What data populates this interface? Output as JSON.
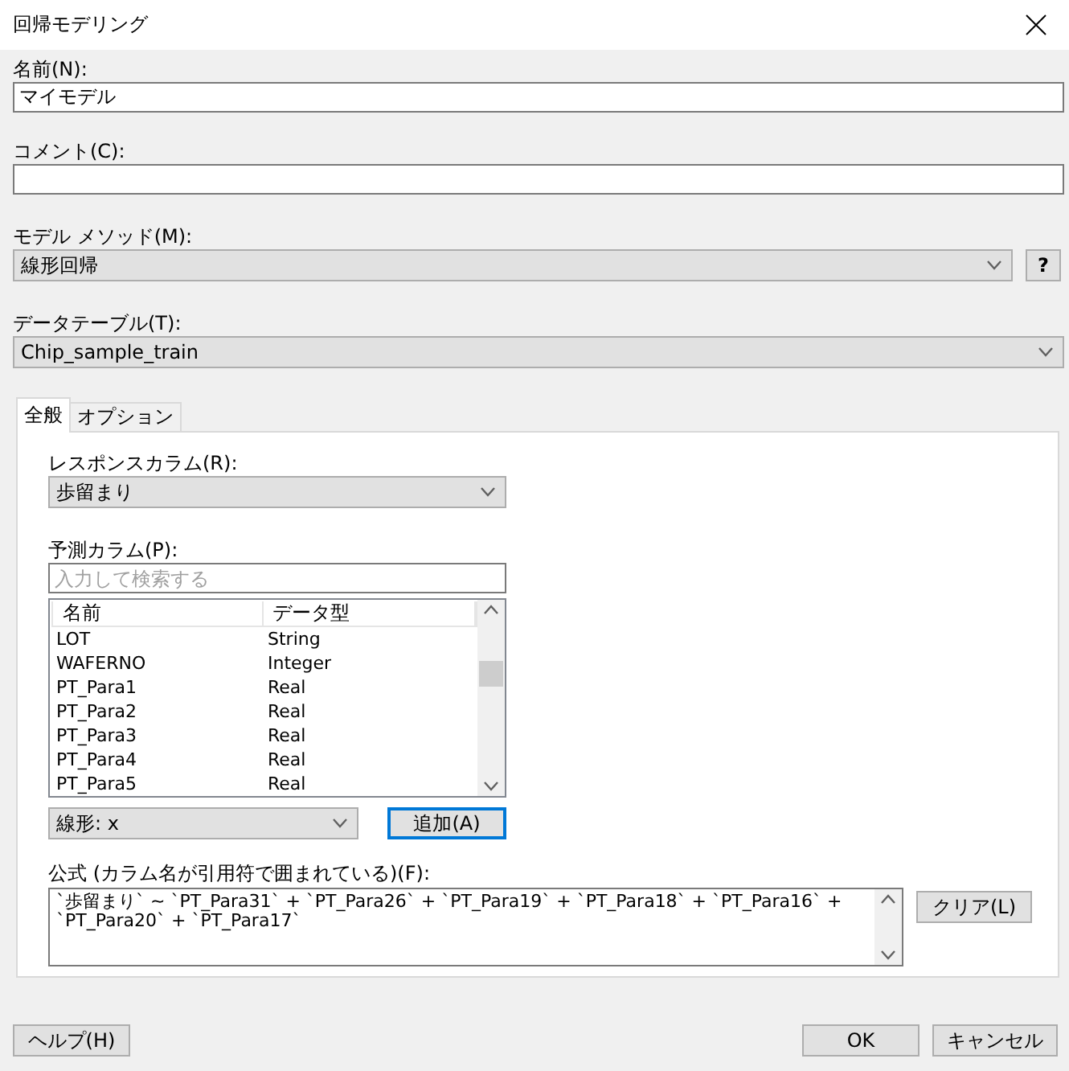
{
  "window": {
    "title": "回帰モデリング"
  },
  "name_field": {
    "label": "名前(N):",
    "value": "マイモデル"
  },
  "comment_field": {
    "label": "コメント(C):"
  },
  "model_method": {
    "label": "モデル メソッド(M):",
    "value": "線形回帰",
    "help_button": "?"
  },
  "data_table": {
    "label": "データテーブル(T):",
    "value": "Chip_sample_train"
  },
  "tabs": [
    {
      "label": "全般",
      "selected": true
    },
    {
      "label": "オプション",
      "selected": false
    }
  ],
  "response_column": {
    "label": "レスポンスカラム(R):",
    "value": "歩留まり"
  },
  "predictor_columns": {
    "label": "予測カラム(P):",
    "search_placeholder": "入力して検索する",
    "columns": [
      "名前",
      "データ型"
    ],
    "rows": [
      {
        "name": "LOT",
        "type": "String"
      },
      {
        "name": "WAFERNO",
        "type": "Integer"
      },
      {
        "name": "PT_Para1",
        "type": "Real"
      },
      {
        "name": "PT_Para2",
        "type": "Real"
      },
      {
        "name": "PT_Para3",
        "type": "Real"
      },
      {
        "name": "PT_Para4",
        "type": "Real"
      },
      {
        "name": "PT_Para5",
        "type": "Real"
      }
    ],
    "term_type": "線形: x",
    "add_button": "追加(A)"
  },
  "formula": {
    "label": "公式 (カラム名が引用符で囲まれている)(F):",
    "value": "`歩留まり` ~ `PT_Para31` + `PT_Para26` + `PT_Para19` + `PT_Para18` + `PT_Para16` + `PT_Para20` + `PT_Para17`",
    "clear_button": "クリア(L)"
  },
  "footer": {
    "help_button": "ヘルプ(H)",
    "ok_button": "OK",
    "cancel_button": "キャンセル"
  }
}
